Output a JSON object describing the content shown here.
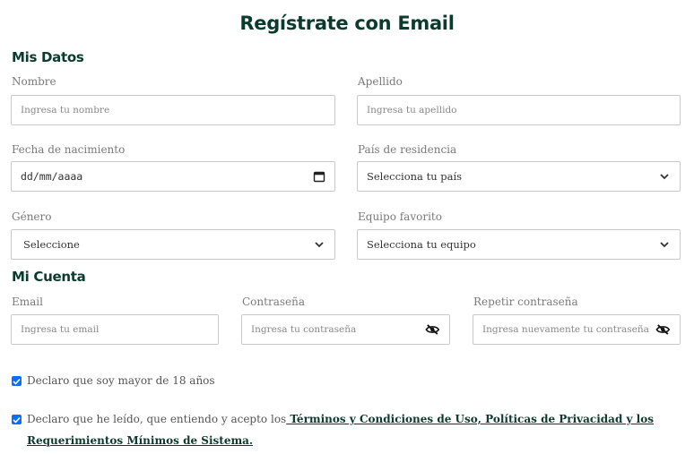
{
  "title": "Regístrate con Email",
  "sections": {
    "personal": "Mis Datos",
    "account": "Mi Cuenta"
  },
  "fields": {
    "nombre": {
      "label": "Nombre",
      "placeholder": "Ingresa tu nombre"
    },
    "apellido": {
      "label": "Apellido",
      "placeholder": "Ingresa tu apellido"
    },
    "fecha": {
      "label": "Fecha de nacimiento",
      "value": "dd/mm/aaaa"
    },
    "pais": {
      "label": "País de residencia",
      "value": "Selecciona tu país"
    },
    "genero": {
      "label": "Género",
      "value": "Seleccione"
    },
    "equipo": {
      "label": "Equipo favorito",
      "value": "Selecciona tu equipo"
    },
    "email": {
      "label": "Email",
      "placeholder": "Ingresa tu email"
    },
    "password": {
      "label": "Contraseña",
      "placeholder": "Ingresa tu contraseña"
    },
    "repeat_password": {
      "label": "Repetir contraseña",
      "placeholder": "Ingresa nuevamente tu contraseña"
    }
  },
  "checks": {
    "age": {
      "checked": true,
      "text": "Declaro que soy mayor de 18 años"
    },
    "terms": {
      "checked": true,
      "text": "Declaro que he leído, que entiendo y acepto los",
      "link": " Términos y Condiciones de Uso, Políticas de Privacidad y los Requerimientos Mínimos de Sistema."
    }
  },
  "icons": {
    "calendar": "calendar-icon",
    "chevron": "chevron-down-icon",
    "eye": "eye-slash-icon",
    "check": "check-icon"
  },
  "colors": {
    "heading": "#0b3b2c",
    "checkbox": "#0d6efd",
    "border": "#c9c9c9"
  }
}
